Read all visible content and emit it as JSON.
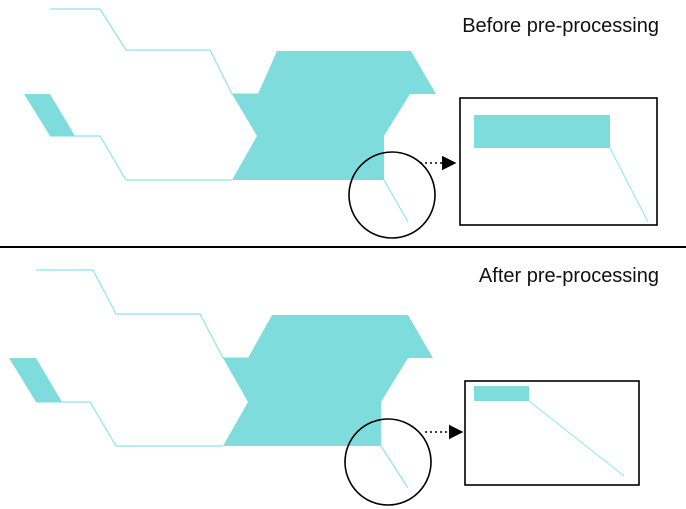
{
  "panels": {
    "before": {
      "title": "Before pre-processing"
    },
    "after": {
      "title": "After pre-processing"
    }
  },
  "colors": {
    "shape_fill": "#7fdcdc",
    "thin_line": "#8ee6e6",
    "outline": "#000000",
    "divider": "#000000"
  }
}
